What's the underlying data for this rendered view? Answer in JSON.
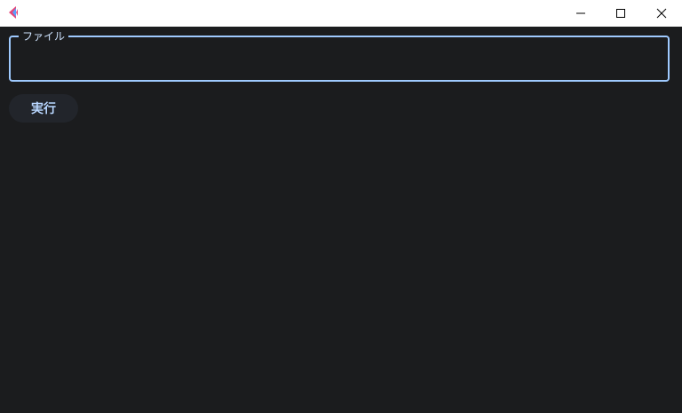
{
  "window": {
    "icons": {
      "app": "app-logo-icon",
      "minimize": "minimize-icon",
      "maximize": "maximize-icon",
      "close": "close-icon"
    }
  },
  "form": {
    "file_label": "ファイル",
    "file_value": "",
    "run_label": "実行"
  },
  "colors": {
    "background": "#1b1c1e",
    "accent": "#9fcaff",
    "button_bg": "#22252b",
    "button_text": "#b8d6ff",
    "logo_pink": "#e5467a",
    "logo_blue": "#5aa0ff"
  }
}
